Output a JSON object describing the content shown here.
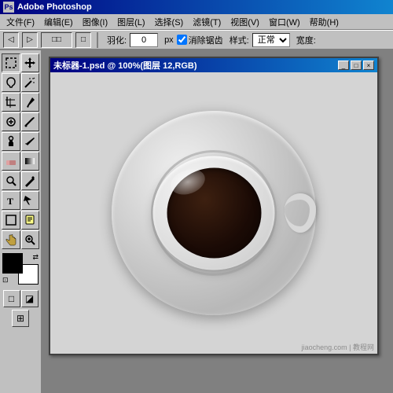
{
  "app": {
    "title": "Adobe Photoshop",
    "title_icon": "Ps"
  },
  "menu": {
    "items": [
      {
        "label": "文件(F)"
      },
      {
        "label": "编辑(E)"
      },
      {
        "label": "图像(I)"
      },
      {
        "label": "图层(L)"
      },
      {
        "label": "选择(S)"
      },
      {
        "label": "滤镜(T)"
      },
      {
        "label": "视图(V)"
      },
      {
        "label": "窗口(W)"
      },
      {
        "label": "帮助(H)"
      }
    ]
  },
  "options_bar": {
    "feather_label": "羽化:",
    "feather_value": "0",
    "feather_unit": "px",
    "anti_alias_label": "消除锯齿",
    "style_label": "样式:",
    "style_value": "正常",
    "width_label": "宽度:"
  },
  "document": {
    "title": "未标器-1.psd @ 100%(图层 12,RGB)",
    "ctrl_minimize": "_",
    "ctrl_maximize": "□",
    "ctrl_close": "×"
  },
  "toolbox": {
    "tools": [
      {
        "name": "marquee",
        "icon": "▭",
        "tooltip": "矩形选框"
      },
      {
        "name": "move",
        "icon": "✛",
        "tooltip": "移动"
      },
      {
        "name": "lasso",
        "icon": "⌇",
        "tooltip": "套索"
      },
      {
        "name": "magic-wand",
        "icon": "✦",
        "tooltip": "魔棒"
      },
      {
        "name": "crop",
        "icon": "⊡",
        "tooltip": "裁切"
      },
      {
        "name": "slice",
        "icon": "⚔",
        "tooltip": "切片"
      },
      {
        "name": "heal",
        "icon": "✚",
        "tooltip": "修复"
      },
      {
        "name": "brush",
        "icon": "✏",
        "tooltip": "画笔"
      },
      {
        "name": "stamp",
        "icon": "⊕",
        "tooltip": "仿制图章"
      },
      {
        "name": "history-brush",
        "icon": "↺",
        "tooltip": "历史记录画笔"
      },
      {
        "name": "eraser",
        "icon": "◻",
        "tooltip": "橡皮擦"
      },
      {
        "name": "gradient",
        "icon": "▤",
        "tooltip": "渐变"
      },
      {
        "name": "dodge",
        "icon": "◑",
        "tooltip": "减淡"
      },
      {
        "name": "pen",
        "icon": "✒",
        "tooltip": "钢笔"
      },
      {
        "name": "text",
        "icon": "T",
        "tooltip": "文字"
      },
      {
        "name": "path-select",
        "icon": "↖",
        "tooltip": "路径选择"
      },
      {
        "name": "shape",
        "icon": "◇",
        "tooltip": "形状"
      },
      {
        "name": "notes",
        "icon": "✎",
        "tooltip": "注释"
      },
      {
        "name": "eyedropper",
        "icon": "✈",
        "tooltip": "吸管"
      },
      {
        "name": "hand",
        "icon": "✋",
        "tooltip": "抓手"
      },
      {
        "name": "zoom",
        "icon": "🔍",
        "tooltip": "缩放"
      }
    ],
    "fg_color": "#000000",
    "bg_color": "#ffffff"
  },
  "watermark": "jiaocheng.com | 教程网"
}
